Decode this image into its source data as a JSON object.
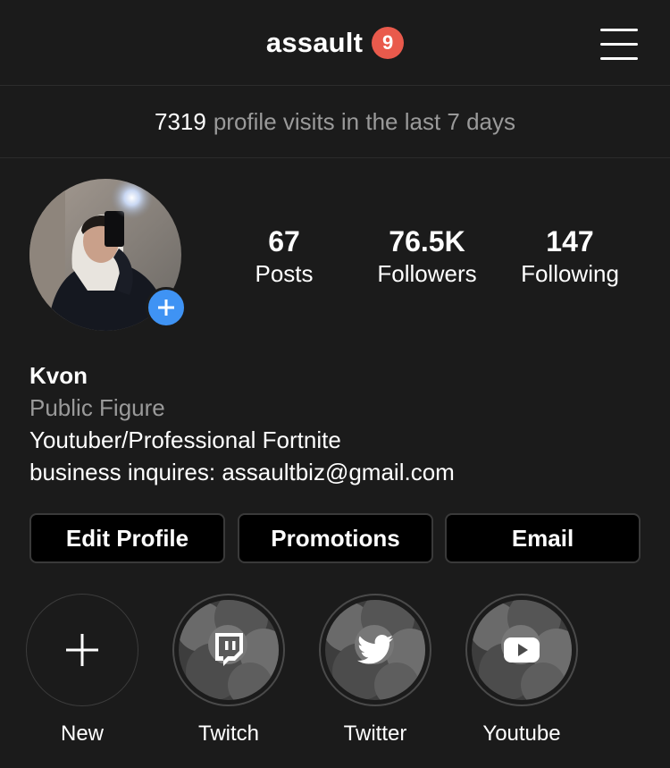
{
  "header": {
    "username": "assault",
    "notification_count": "9",
    "menu_icon": "hamburger-menu-icon"
  },
  "insights": {
    "visits_count": "7319",
    "visits_text": "profile visits in the last 7 days"
  },
  "profile": {
    "stats": [
      {
        "value": "67",
        "label": "Posts"
      },
      {
        "value": "76.5K",
        "label": "Followers"
      },
      {
        "value": "147",
        "label": "Following"
      }
    ],
    "name": "Kvon",
    "category": "Public Figure",
    "bio_lines": [
      "Youtuber/Professional Fortnite",
      "business inquires: assaultbiz@gmail.com"
    ]
  },
  "actions": {
    "edit_profile": "Edit Profile",
    "promotions": "Promotions",
    "email": "Email"
  },
  "highlights": [
    {
      "label": "New",
      "icon": "plus-icon"
    },
    {
      "label": "Twitch",
      "icon": "twitch-icon"
    },
    {
      "label": "Twitter",
      "icon": "twitter-bird-icon"
    },
    {
      "label": "Youtube",
      "icon": "youtube-play-icon"
    }
  ],
  "colors": {
    "background": "#1b1b1b",
    "badge": "#e95a4c",
    "add_story": "#3f93f4",
    "muted_text": "#9a9a9a"
  }
}
